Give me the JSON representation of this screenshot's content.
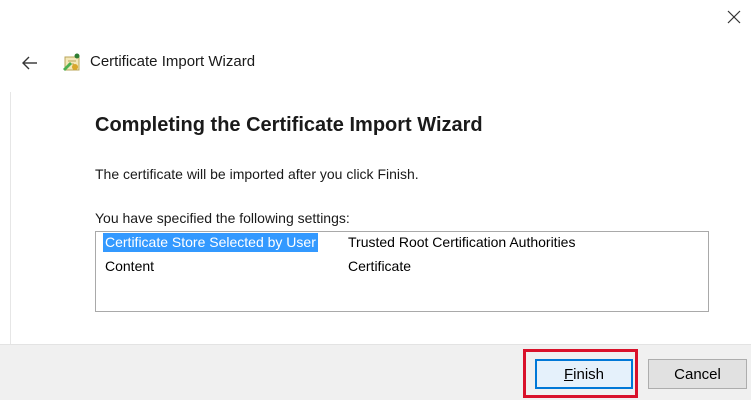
{
  "window": {
    "close_icon": "close-icon"
  },
  "header": {
    "back_icon": "back-arrow-icon",
    "wizard_icon": "certificate-wizard-icon",
    "title": "Certificate Import Wizard"
  },
  "content": {
    "heading": "Completing the Certificate Import Wizard",
    "info_text": "The certificate will be imported after you click Finish.",
    "settings_label": "You have specified the following settings:",
    "settings": [
      {
        "key": "Certificate Store Selected by User",
        "value": "Trusted Root Certification Authorities",
        "selected": true
      },
      {
        "key": "Content",
        "value": "Certificate",
        "selected": false
      }
    ]
  },
  "footer": {
    "finish_label_underlined": "F",
    "finish_label_rest": "inish",
    "cancel_label": "Cancel",
    "highlight_color": "#d9112a"
  },
  "colors": {
    "selection": "#3399ff",
    "footer_bg": "#f0f0f0",
    "accent": "#0078d7"
  }
}
